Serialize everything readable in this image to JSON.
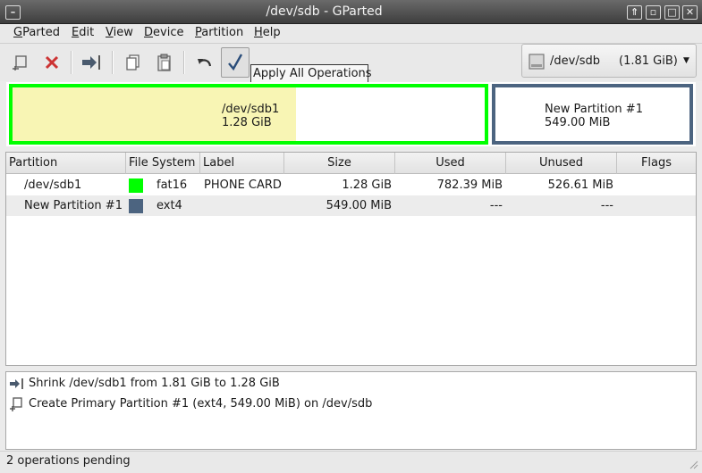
{
  "window": {
    "title": "/dev/sdb - GParted"
  },
  "menubar": {
    "items": [
      {
        "label": "GParted",
        "mnemonic": "G",
        "rest": "Parted"
      },
      {
        "label": "Edit",
        "mnemonic": "E",
        "rest": "dit"
      },
      {
        "label": "View",
        "mnemonic": "V",
        "rest": "iew"
      },
      {
        "label": "Device",
        "mnemonic": "D",
        "rest": "evice"
      },
      {
        "label": "Partition",
        "mnemonic": "P",
        "rest": "artition"
      },
      {
        "label": "Help",
        "mnemonic": "H",
        "rest": "elp"
      }
    ]
  },
  "toolbar": {
    "tooltip": "Apply All Operations",
    "device_name": "/dev/sdb",
    "device_size": "(1.81 GiB)"
  },
  "visual": {
    "partitions": [
      {
        "name": "/dev/sdb1",
        "size": "1.28 GiB",
        "border_color": "#00ff00",
        "fill_color": "#f8f5b4",
        "used_fraction": 0.6
      },
      {
        "name": "New Partition #1",
        "size": "549.00 MiB",
        "border_color": "#4c6480",
        "fill_color": "#ffffff",
        "used_fraction": 0
      }
    ]
  },
  "table": {
    "headers": [
      "Partition",
      "File System",
      "Label",
      "Size",
      "Used",
      "Unused",
      "Flags"
    ],
    "rows": [
      {
        "partition": "/dev/sdb1",
        "fs": "fat16",
        "fs_color": "#00ff00",
        "label": "PHONE CARD",
        "size": "1.28 GiB",
        "used": "782.39 MiB",
        "unused": "526.61 MiB",
        "flags": ""
      },
      {
        "partition": "New Partition #1",
        "fs": "ext4",
        "fs_color": "#4c6480",
        "label": "",
        "size": "549.00 MiB",
        "used": "---",
        "unused": "---",
        "flags": ""
      }
    ]
  },
  "operations": [
    {
      "icon": "resize-icon",
      "text": "Shrink /dev/sdb1 from 1.81 GiB to 1.28 GiB"
    },
    {
      "icon": "new-partition-icon",
      "text": "Create Primary Partition #1 (ext4, 549.00 MiB) on /dev/sdb"
    }
  ],
  "status": {
    "text": "2 operations pending"
  }
}
